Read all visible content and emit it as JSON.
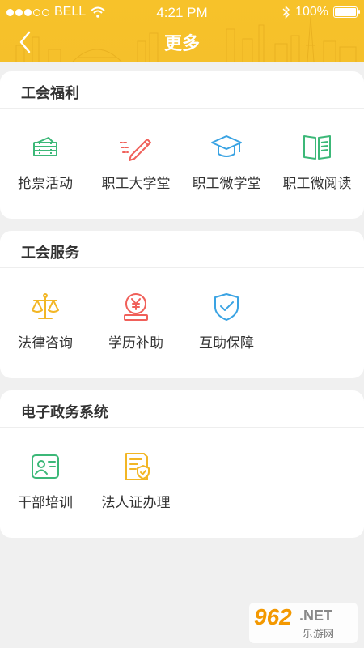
{
  "status_bar": {
    "carrier": "BELL",
    "time": "4:21 PM",
    "battery": "100%"
  },
  "nav": {
    "title": "更多",
    "back_icon": "chevron-left-icon"
  },
  "sections": [
    {
      "title": "工会福利",
      "items": [
        {
          "label": "抢票活动",
          "icon": "ticket-icon"
        },
        {
          "label": "职工大学堂",
          "icon": "pen-icon"
        },
        {
          "label": "职工微学堂",
          "icon": "graduation-cap-icon"
        },
        {
          "label": "职工微阅读",
          "icon": "open-book-icon"
        }
      ]
    },
    {
      "title": "工会服务",
      "items": [
        {
          "label": "法律咨询",
          "icon": "scales-icon"
        },
        {
          "label": "学历补助",
          "icon": "yuan-coin-icon"
        },
        {
          "label": "互助保障",
          "icon": "shield-check-icon"
        }
      ]
    },
    {
      "title": "电子政务系统",
      "items": [
        {
          "label": "干部培训",
          "icon": "profile-card-icon"
        },
        {
          "label": "法人证办理",
          "icon": "certificate-icon"
        }
      ]
    }
  ],
  "watermark": {
    "brand": "962",
    "suffix": ".NET",
    "site": "乐游网"
  },
  "colors": {
    "header": "#f7c22a",
    "green": "#3cb878",
    "red": "#f0605a",
    "blue": "#3aa3e3",
    "yellow": "#f2b625"
  }
}
